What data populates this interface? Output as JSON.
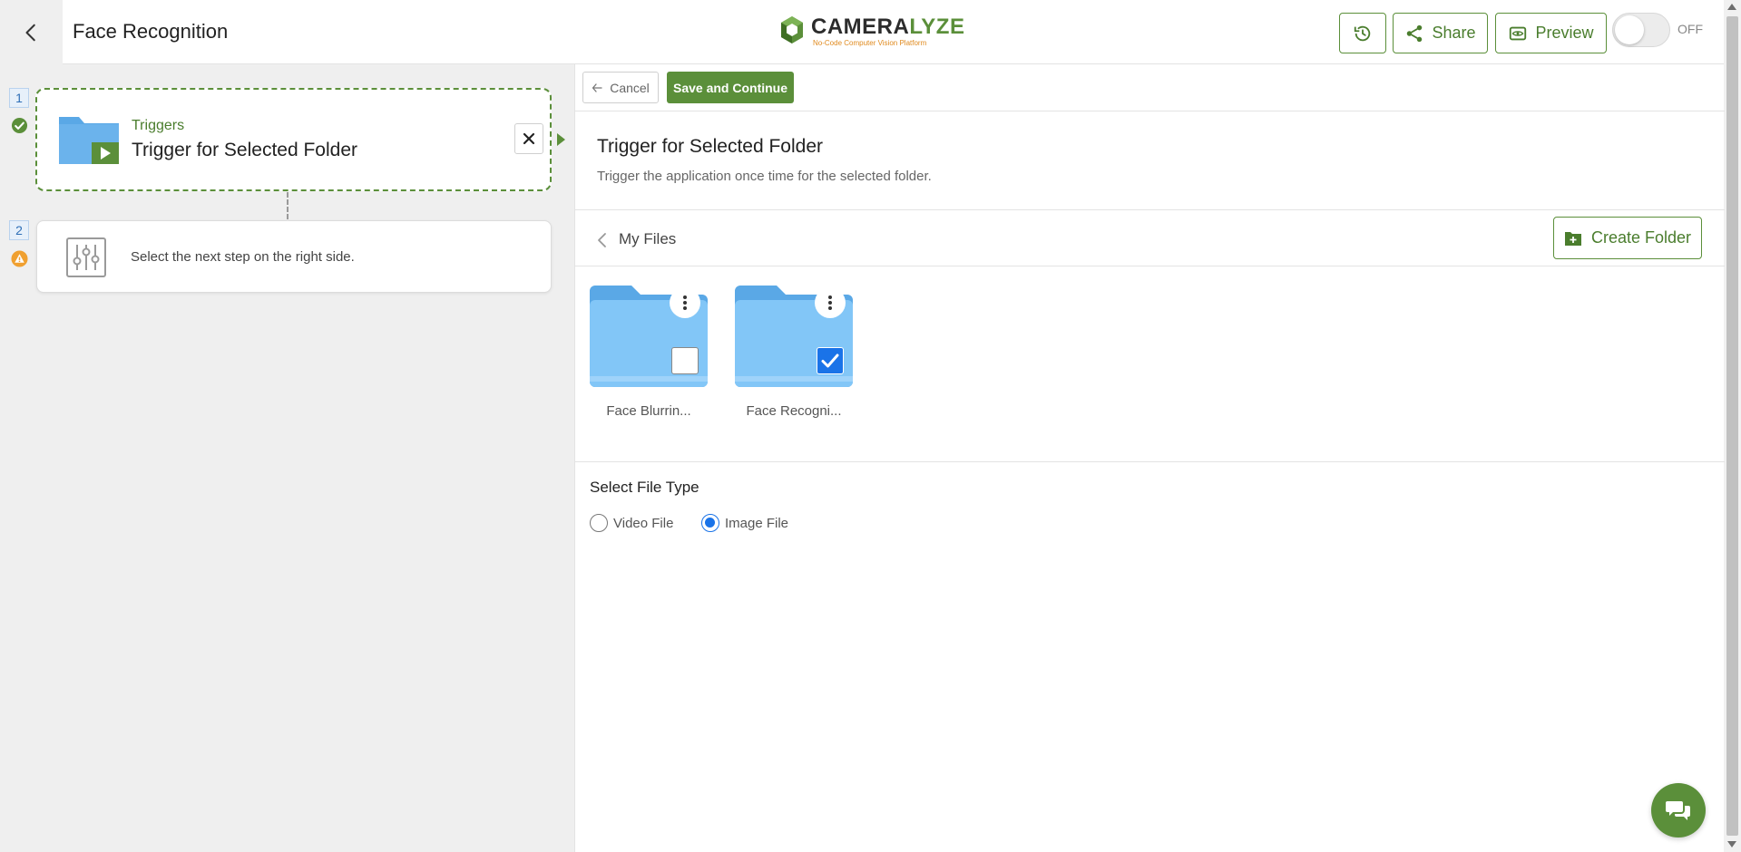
{
  "header": {
    "back_icon": "chevron-left-icon",
    "title": "Face Recognition",
    "logo": {
      "wordmark_main": "CAMERA",
      "wordmark_accent": "LYZE",
      "tagline": "No-Code Computer Vision Platform"
    },
    "history_icon": "history-icon",
    "share_label": "Share",
    "share_icon": "share-icon",
    "preview_label": "Preview",
    "preview_icon": "eye-icon",
    "toggle_label": "OFF",
    "toggle_on": false
  },
  "flow": {
    "steps": [
      {
        "number": "1",
        "status": "success",
        "kicker": "Triggers",
        "title": "Trigger for Selected Folder"
      },
      {
        "number": "2",
        "status": "warning",
        "text": "Select the next step on the right side."
      }
    ]
  },
  "panel": {
    "cancel_label": "Cancel",
    "save_label": "Save and Continue",
    "title": "Trigger for Selected Folder",
    "description": "Trigger the application once time for the selected folder.",
    "files": {
      "breadcrumb": "My Files",
      "create_label": "Create Folder",
      "folders": [
        {
          "label": "Face Blurrin...",
          "checked": false
        },
        {
          "label": "Face Recogni...",
          "checked": true
        }
      ]
    },
    "file_type": {
      "title": "Select File Type",
      "options": [
        {
          "label": "Video File",
          "selected": false
        },
        {
          "label": "Image File",
          "selected": true
        }
      ]
    }
  },
  "colors": {
    "accent": "#5b8f3a",
    "folder": "#82c6f7",
    "folder_dark": "#5aa8e6",
    "checkbox_on": "#1a73e8",
    "warning": "#f0a030"
  },
  "chat_icon": "chat-bubbles-icon"
}
